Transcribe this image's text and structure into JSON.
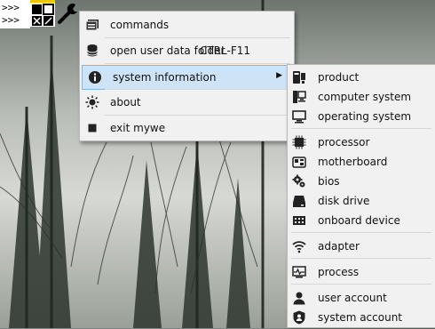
{
  "widget": {
    "prompt_line_1": ">>>",
    "prompt_line_2": ">>>"
  },
  "main_menu": {
    "items": [
      {
        "label": "commands",
        "icon": "window-icon"
      },
      {
        "label": "open user data folder",
        "shortcut": "CTRL-F11",
        "icon": "database-icon"
      },
      {
        "label": "system information",
        "icon": "info-icon",
        "has_submenu": true,
        "arrow": "▶"
      },
      {
        "label": "about",
        "icon": "lightbulb-icon"
      },
      {
        "label": "exit mywe",
        "icon": "stop-icon"
      }
    ]
  },
  "submenu": {
    "items": [
      {
        "label": "product",
        "icon": "phone-monitor-icon"
      },
      {
        "label": "computer system",
        "icon": "desktop-tower-icon"
      },
      {
        "label": "operating system",
        "icon": "monitor-icon"
      },
      {
        "label": "processor",
        "icon": "cpu-icon"
      },
      {
        "label": "motherboard",
        "icon": "motherboard-icon"
      },
      {
        "label": "bios",
        "icon": "gears-icon"
      },
      {
        "label": "disk drive",
        "icon": "hard-drive-icon"
      },
      {
        "label": "onboard device",
        "icon": "chip-icon"
      },
      {
        "label": "adapter",
        "icon": "wifi-icon"
      },
      {
        "label": "process",
        "icon": "activity-monitor-icon"
      },
      {
        "label": "user account",
        "icon": "user-icon"
      },
      {
        "label": "system account",
        "icon": "shield-user-icon"
      }
    ]
  },
  "colors": {
    "menu_bg": "#f1f1f1",
    "selection_bg": "#cfe3f7",
    "selection_border": "#87b5e0"
  }
}
